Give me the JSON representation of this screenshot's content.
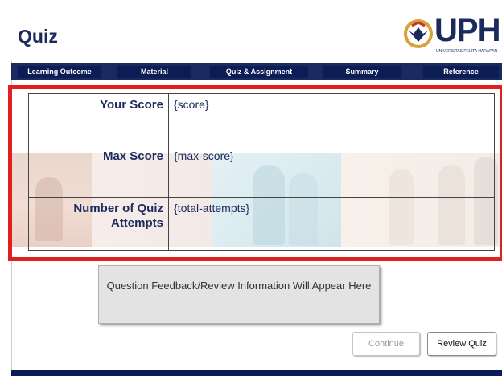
{
  "header": {
    "title": "Quiz",
    "logo_text": "UPH",
    "logo_subtitle": "UNIVERSITAS PELITA HARAPAN"
  },
  "nav": {
    "items": [
      {
        "label": "Learning Outcome"
      },
      {
        "label": "Material"
      },
      {
        "label": "Quiz & Assignment"
      },
      {
        "label": "Summary"
      },
      {
        "label": "Reference"
      }
    ]
  },
  "results": {
    "rows": [
      {
        "label": "Your Score",
        "value": "{score}"
      },
      {
        "label": "Max Score",
        "value": "{max-score}"
      },
      {
        "label": "Number of Quiz Attempts",
        "value": "{total-attempts}"
      }
    ]
  },
  "feedback": {
    "text": "Question Feedback/Review Information Will Appear Here"
  },
  "buttons": {
    "continue_label": "Continue",
    "review_label": "Review Quiz"
  },
  "colors": {
    "brand_navy": "#1a2a5e",
    "highlight_red": "#e02020"
  }
}
